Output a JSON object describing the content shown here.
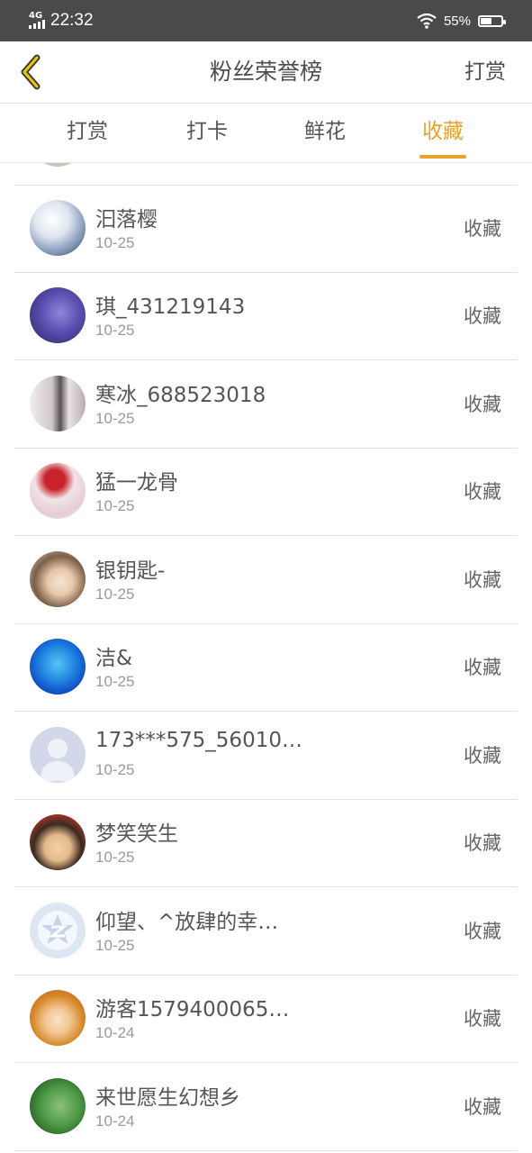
{
  "status_bar": {
    "network": "4G",
    "time": "22:32",
    "battery": "55%",
    "battery_level": 0.55
  },
  "header": {
    "title": "粉丝荣誉榜",
    "right_action": "打赏"
  },
  "tabs": [
    {
      "label": "打赏",
      "active": false
    },
    {
      "label": "打卡",
      "active": false
    },
    {
      "label": "鲜花",
      "active": false
    },
    {
      "label": "收藏",
      "active": true
    }
  ],
  "rows": [
    {
      "name": "汩落樱",
      "date": "10-25",
      "action": "收藏"
    },
    {
      "name": "琪_431219143",
      "date": "10-25",
      "action": "收藏"
    },
    {
      "name": "寒冰_688523018",
      "date": "10-25",
      "action": "收藏"
    },
    {
      "name": "猛一龙骨",
      "date": "10-25",
      "action": "收藏"
    },
    {
      "name": "银钥匙-",
      "date": "10-25",
      "action": "收藏"
    },
    {
      "name": "洁&",
      "date": "10-25",
      "action": "收藏"
    },
    {
      "name": "173***575_56010…",
      "date": "10-25",
      "action": "收藏"
    },
    {
      "name": "梦笑笑生",
      "date": "10-25",
      "action": "收藏"
    },
    {
      "name": "仰望、^放肆的幸…",
      "date": "10-25",
      "action": "收藏"
    },
    {
      "name": "游客1579400065…",
      "date": "10-24",
      "action": "收藏"
    },
    {
      "name": "来世愿生幻想乡",
      "date": "10-24",
      "action": "收藏"
    }
  ],
  "colors": {
    "accent": "#e8a22a",
    "status_bar": "#4a4a4a",
    "text": "#555555",
    "subtext": "#9a9a9a"
  },
  "icons": {
    "back": "chevron-left-icon",
    "wifi": "wifi-icon",
    "battery": "battery-icon",
    "signal": "signal-icon"
  }
}
